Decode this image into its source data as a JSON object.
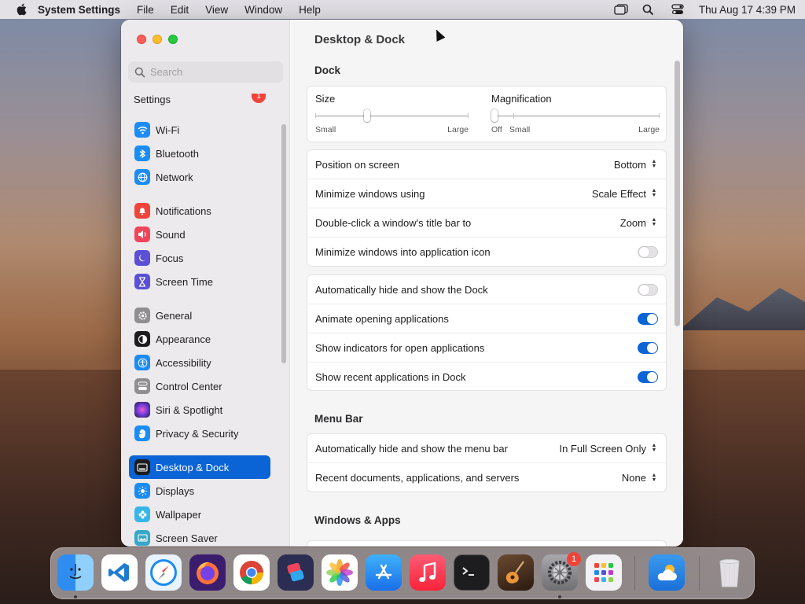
{
  "menubar": {
    "app": "System Settings",
    "items": [
      "File",
      "Edit",
      "View",
      "Window",
      "Help"
    ],
    "datetime": "Thu Aug 17  4:39 PM"
  },
  "window": {
    "title": "Desktop & Dock"
  },
  "sidebar": {
    "search_placeholder": "Search",
    "top_partial": "Settings",
    "top_badge": "1",
    "items": [
      {
        "label": "Wi-Fi",
        "icon": "wifi-icon",
        "color": "#1b8cf5"
      },
      {
        "label": "Bluetooth",
        "icon": "bluetooth-icon",
        "color": "#1b8cf5"
      },
      {
        "label": "Network",
        "icon": "globe-icon",
        "color": "#1b8cf5"
      },
      {
        "label": "Notifications",
        "icon": "bell-icon",
        "color": "#f0443a"
      },
      {
        "label": "Sound",
        "icon": "speaker-icon",
        "color": "#f0445a"
      },
      {
        "label": "Focus",
        "icon": "moon-icon",
        "color": "#5b4fd6"
      },
      {
        "label": "Screen Time",
        "icon": "hourglass-icon",
        "color": "#5b4fd6"
      },
      {
        "label": "General",
        "icon": "gear-icon",
        "color": "#8e8e93"
      },
      {
        "label": "Appearance",
        "icon": "appearance-icon",
        "color": "#1d1d1f"
      },
      {
        "label": "Accessibility",
        "icon": "accessibility-icon",
        "color": "#1b8cf5"
      },
      {
        "label": "Control Center",
        "icon": "control-center-icon",
        "color": "#8e8e93"
      },
      {
        "label": "Siri & Spotlight",
        "icon": "siri-icon",
        "color": "#c03ac8"
      },
      {
        "label": "Privacy & Security",
        "icon": "hand-icon",
        "color": "#1b8cf5"
      },
      {
        "label": "Desktop & Dock",
        "icon": "dock-icon",
        "color": "#1d1d1f"
      },
      {
        "label": "Displays",
        "icon": "sun-icon",
        "color": "#1b8cf5"
      },
      {
        "label": "Wallpaper",
        "icon": "flower-icon",
        "color": "#38b6e8"
      },
      {
        "label": "Screen Saver",
        "icon": "screensaver-icon",
        "color": "#38a8c8"
      }
    ]
  },
  "dock_section": {
    "title": "Dock",
    "size_label": "Size",
    "size_min": "Small",
    "size_max": "Large",
    "size_level": 0.33,
    "mag_label": "Magnification",
    "mag_off": "Off",
    "mag_min": "Small",
    "mag_max": "Large",
    "mag_level": 0.0,
    "rows1": [
      {
        "label": "Position on screen",
        "value": "Bottom"
      },
      {
        "label": "Minimize windows using",
        "value": "Scale Effect"
      },
      {
        "label": "Double-click a window's title bar to",
        "value": "Zoom"
      }
    ],
    "minimize_icon_label": "Minimize windows into application icon",
    "minimize_icon_on": false,
    "toggles": [
      {
        "label": "Automatically hide and show the Dock",
        "on": false
      },
      {
        "label": "Animate opening applications",
        "on": true
      },
      {
        "label": "Show indicators for open applications",
        "on": true
      },
      {
        "label": "Show recent applications in Dock",
        "on": true
      }
    ]
  },
  "menu_bar_section": {
    "title": "Menu Bar",
    "rows": [
      {
        "label": "Automatically hide and show the menu bar",
        "value": "In Full Screen Only"
      },
      {
        "label": "Recent documents, applications, and servers",
        "value": "None"
      }
    ]
  },
  "windows_apps_section": {
    "title": "Windows & Apps"
  },
  "dock": {
    "apps": [
      {
        "name": "Finder",
        "icon": "finder-icon",
        "color": "#2f8cf0",
        "running": true
      },
      {
        "name": "Visual Studio Code",
        "icon": "vscode-icon",
        "color": "#ffffff",
        "running": false
      },
      {
        "name": "Safari",
        "icon": "safari-icon",
        "color": "#e8f3ff",
        "running": false
      },
      {
        "name": "Firefox",
        "icon": "firefox-icon",
        "color": "#3b1d6e",
        "running": false
      },
      {
        "name": "Chrome",
        "icon": "chrome-icon",
        "color": "#ffffff",
        "running": false
      },
      {
        "name": "Shortcuts",
        "icon": "shortcuts-icon",
        "color": "#2b2d52",
        "running": false
      },
      {
        "name": "Photos",
        "icon": "photos-icon",
        "color": "#ffffff",
        "running": false
      },
      {
        "name": "App Store",
        "icon": "appstore-icon",
        "color": "#1b8cf5",
        "running": false
      },
      {
        "name": "Music",
        "icon": "music-icon",
        "color": "#fa3c52",
        "running": false
      },
      {
        "name": "Terminal",
        "icon": "terminal-icon",
        "color": "#1d1d1f",
        "running": false
      },
      {
        "name": "GarageBand",
        "icon": "guitar-icon",
        "color": "#3d2a1a",
        "running": false
      },
      {
        "name": "System Settings",
        "icon": "settings-gear-icon",
        "color": "#8e8e93",
        "running": true,
        "badge": "1"
      },
      {
        "name": "Launchpad",
        "icon": "launchpad-icon",
        "color": "#f2f2f4",
        "running": false
      }
    ],
    "recent": [
      {
        "name": "Weather",
        "icon": "weather-icon",
        "color": "#2a8de8"
      }
    ],
    "trash": {
      "name": "Trash",
      "icon": "trash-icon"
    }
  }
}
